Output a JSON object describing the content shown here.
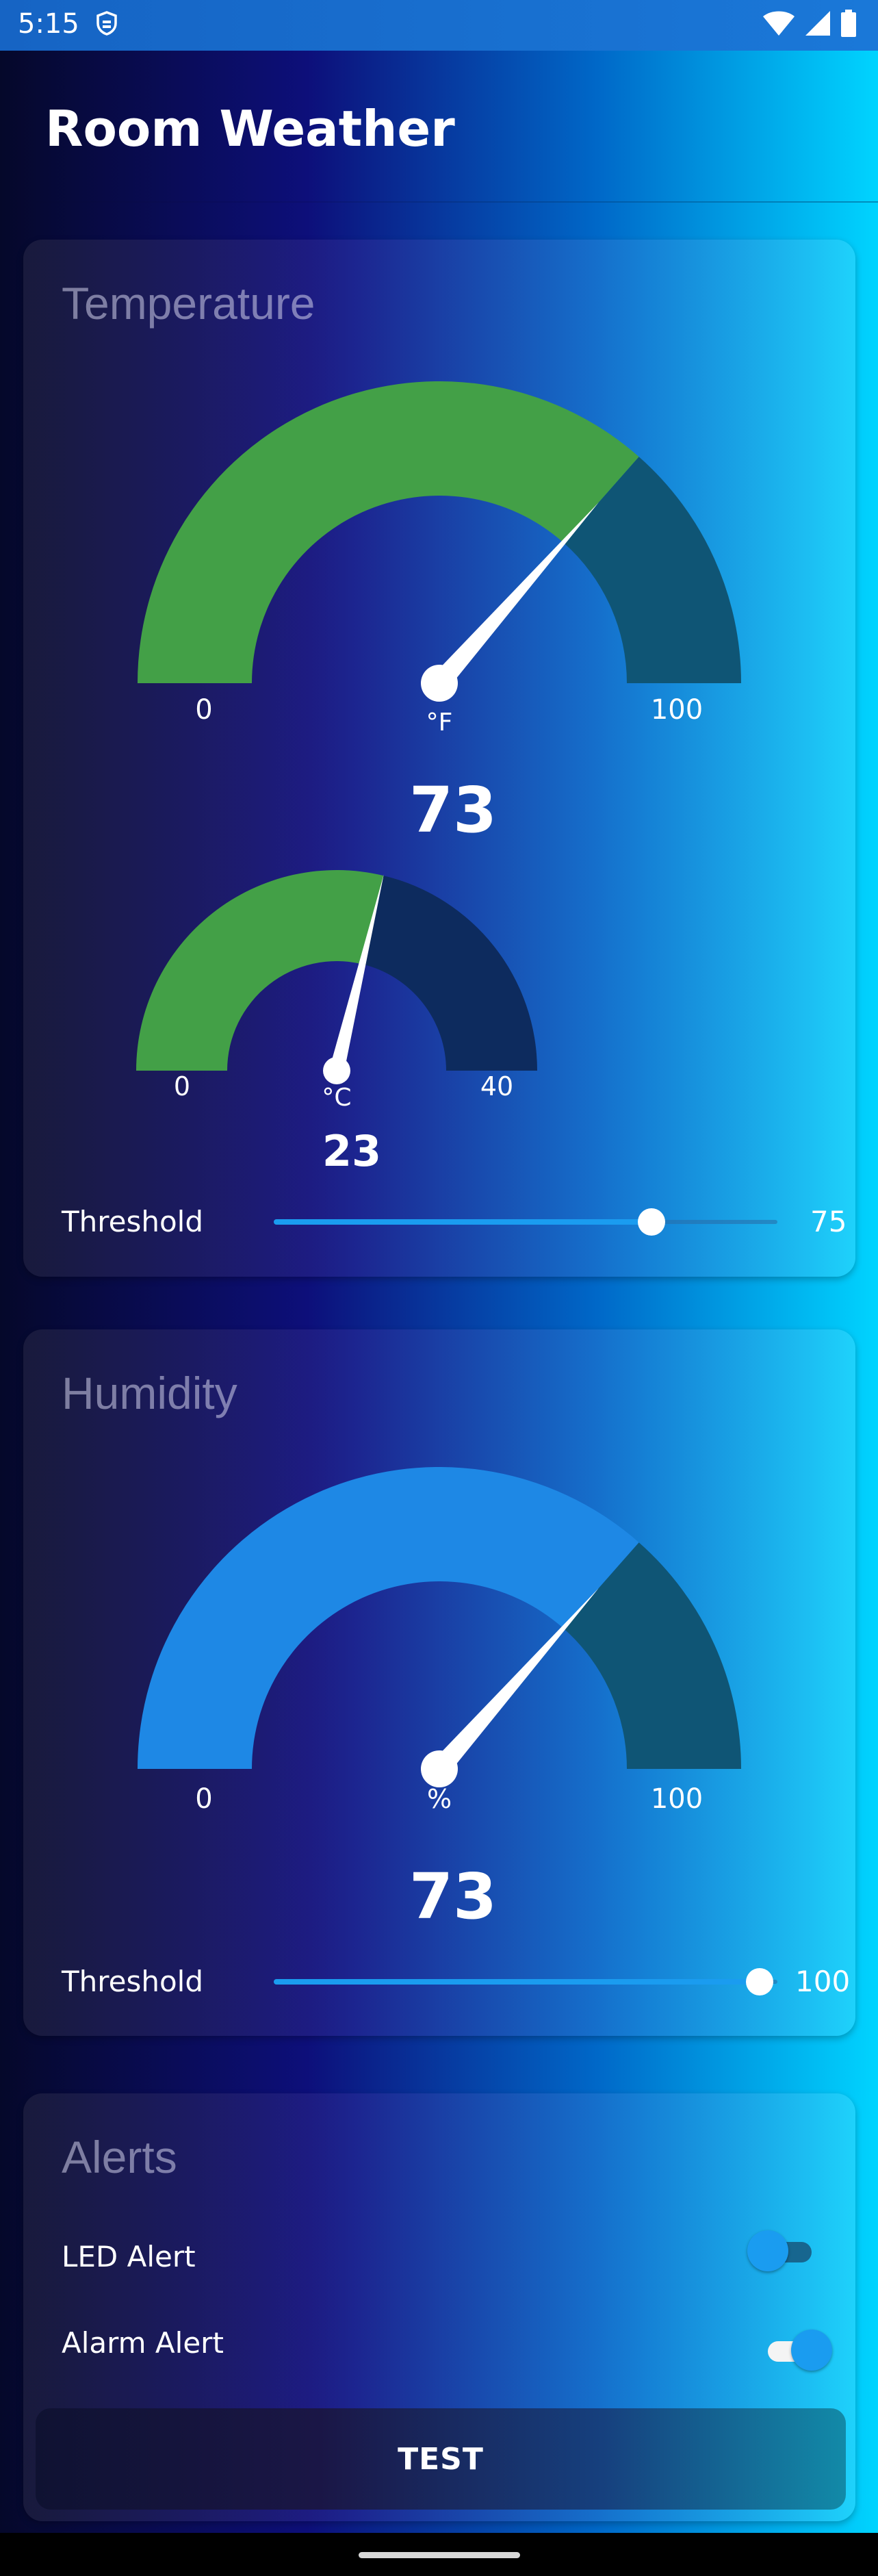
{
  "status_bar": {
    "time": "5:15"
  },
  "app_bar": {
    "title": "Room Weather"
  },
  "temperature": {
    "title": "Temperature",
    "fahrenheit": {
      "min_label": "0",
      "max_label": "100",
      "unit": "°F",
      "value": "73",
      "fraction": 0.73
    },
    "celsius": {
      "min_label": "0",
      "max_label": "40",
      "unit": "°C",
      "value": "23",
      "fraction": 0.575
    },
    "threshold": {
      "label": "Threshold",
      "value": "75",
      "fraction": 0.75
    }
  },
  "humidity": {
    "title": "Humidity",
    "gauge": {
      "min_label": "0",
      "max_label": "100",
      "unit": "%",
      "value": "73",
      "fraction": 0.73
    },
    "threshold": {
      "label": "Threshold",
      "value": "100",
      "fraction": 0.965
    }
  },
  "alerts": {
    "title": "Alerts",
    "led": {
      "label": "LED Alert",
      "on": false
    },
    "alarm": {
      "label": "Alarm Alert",
      "on": true
    },
    "test_label": "TEST"
  },
  "colors": {
    "temp_fill": "#43a047",
    "humidity_fill": "#1e88e5",
    "gauge_rest": "#0f5575",
    "celsius_rest": "#0d2b5e",
    "slider_active": "#1a9cf0"
  },
  "icons": [
    "shield-icon",
    "wifi-icon",
    "signal-icon",
    "battery-icon"
  ]
}
